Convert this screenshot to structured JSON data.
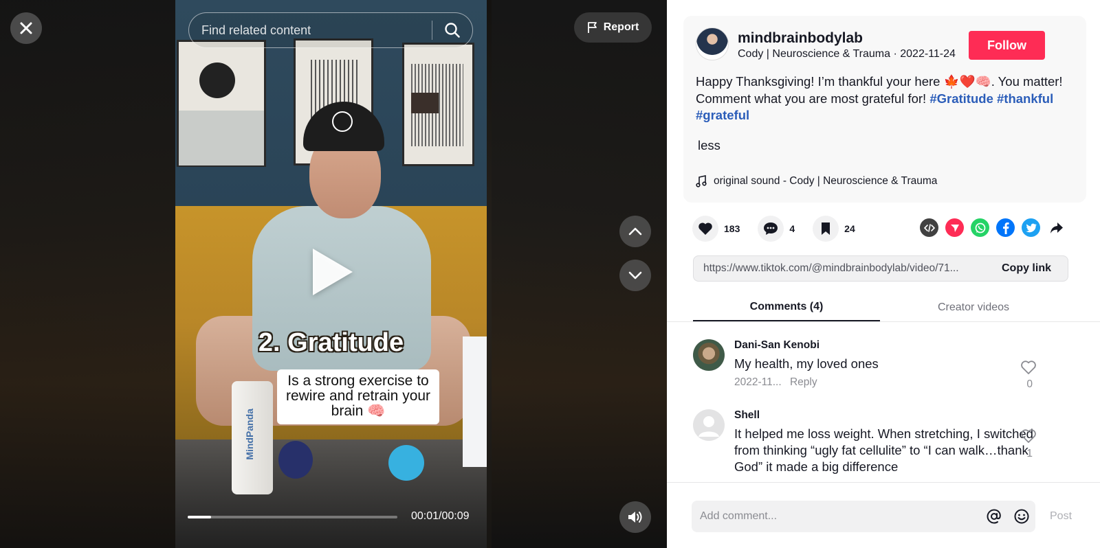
{
  "video": {
    "search_placeholder": "Find related content",
    "report_label": "Report",
    "overlay_title": "2. Gratitude",
    "overlay_caption": "Is a strong exercise to rewire and retrain your brain 🧠",
    "bottle_brand": "MindPanda",
    "time": "00:01/00:09",
    "progress_fraction": 0.11
  },
  "author": {
    "username": "mindbrainbodylab",
    "display": "Cody | Neuroscience & Trauma · 2022-11-24",
    "follow_label": "Follow"
  },
  "caption": {
    "text": "Happy Thanksgiving! I’m thankful your here 🍁❤️🧠. You matter! Comment what you are most grateful for! ",
    "hashtags": [
      "#Gratitude",
      "#thankful",
      "#grateful"
    ],
    "less_label": "less",
    "music": "original sound - Cody | Neuroscience & Trauma"
  },
  "stats": {
    "likes": "183",
    "comments": "4",
    "saves": "24"
  },
  "share": {
    "link": "https://www.tiktok.com/@mindbrainbodylab/video/71...",
    "copy_label": "Copy link"
  },
  "tabs": {
    "comments": "Comments (4)",
    "creator": "Creator videos"
  },
  "comments": [
    {
      "user": "Dani-San Kenobi",
      "text": "My health, my loved ones",
      "date": "2022-11...",
      "reply": "Reply",
      "likes": "0"
    },
    {
      "user": "Shell",
      "text": "It helped me loss weight. When stretching, I switched from thinking “ugly fat cellulite” to “I can walk…thank God” it made a big difference",
      "likes": "1"
    }
  ],
  "composer": {
    "placeholder": "Add comment...",
    "post_label": "Post"
  },
  "colors": {
    "follow": "#fe2c55",
    "hashtag": "#2b5db9",
    "embed": "#414141",
    "send": "#fe2c55",
    "whatsapp": "#25d366",
    "facebook": "#0075fa",
    "twitter": "#1da1f2"
  },
  "icons": [
    "close-icon",
    "search-icon",
    "flag-icon",
    "play-icon",
    "chevron-up-icon",
    "chevron-down-icon",
    "volume-icon",
    "heart-icon",
    "comment-icon",
    "bookmark-icon",
    "embed-icon",
    "send-icon",
    "whatsapp-icon",
    "facebook-icon",
    "twitter-icon",
    "share-arrow-icon",
    "music-note-icon",
    "at-icon",
    "emoji-icon"
  ]
}
